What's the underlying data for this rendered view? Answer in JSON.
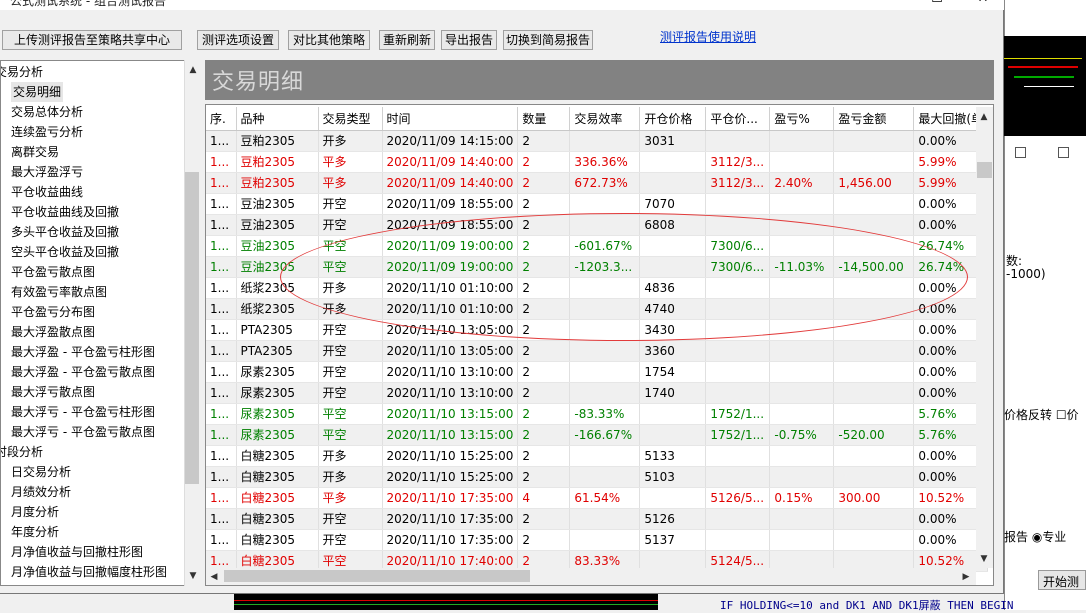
{
  "window": {
    "title": "公式测试系统 - 组合测试报告",
    "controls": {
      "minimize": "—",
      "maximize": "☐",
      "close": "✕"
    }
  },
  "toolbar": {
    "upload_label": "上传测评报告至策略共享中心",
    "options_label": "测评选项设置",
    "compare_label": "对比其他策略",
    "refresh_label": "重新刷新",
    "export_label": "导出报告",
    "switch_label": "切换到简易报告",
    "help_link": "测评报告使用说明"
  },
  "tree": {
    "items": [
      {
        "label": "交易分析",
        "level": 0
      },
      {
        "label": "交易明细",
        "level": 1,
        "selected": true
      },
      {
        "label": "交易总体分析",
        "level": 1
      },
      {
        "label": "连续盈亏分析",
        "level": 1
      },
      {
        "label": "离群交易",
        "level": 1
      },
      {
        "label": "最大浮盈浮亏",
        "level": 1
      },
      {
        "label": "平仓收益曲线",
        "level": 1
      },
      {
        "label": "平仓收益曲线及回撤",
        "level": 1
      },
      {
        "label": "多头平仓收益及回撤",
        "level": 1
      },
      {
        "label": "空头平仓收益及回撤",
        "level": 1
      },
      {
        "label": "平仓盈亏散点图",
        "level": 1
      },
      {
        "label": "有效盈亏率散点图",
        "level": 1
      },
      {
        "label": "平仓盈亏分布图",
        "level": 1
      },
      {
        "label": "最大浮盈散点图",
        "level": 1
      },
      {
        "label": "最大浮盈 - 平仓盈亏柱形图",
        "level": 1
      },
      {
        "label": "最大浮盈 - 平仓盈亏散点图",
        "level": 1
      },
      {
        "label": "最大浮亏散点图",
        "level": 1
      },
      {
        "label": "最大浮亏 - 平仓盈亏柱形图",
        "level": 1
      },
      {
        "label": "最大浮亏 - 平仓盈亏散点图",
        "level": 1
      },
      {
        "label": "时段分析",
        "level": 0
      },
      {
        "label": "日交易分析",
        "level": 1
      },
      {
        "label": "月绩效分析",
        "level": 1
      },
      {
        "label": "月度分析",
        "level": 1
      },
      {
        "label": "年度分析",
        "level": 1
      },
      {
        "label": "月净值收益与回撤柱形图",
        "level": 1
      },
      {
        "label": "月净值收益与回撤幅度柱形图",
        "level": 1
      }
    ]
  },
  "panel": {
    "header": "交易明细"
  },
  "table": {
    "columns": [
      "序.",
      "品种",
      "交易类型",
      "时间",
      "数量",
      "交易效率",
      "开仓价格",
      "平仓价...",
      "盈亏%",
      "盈亏金额",
      "最大回撤(单"
    ],
    "rows": [
      {
        "color": "blk",
        "cells": [
          "1...",
          "豆粕2305",
          "开多",
          "2020/11/09 14:15:00",
          "2",
          "",
          "3031",
          "",
          "",
          "",
          "0.00%"
        ]
      },
      {
        "color": "red",
        "cells": [
          "1...",
          "豆粕2305",
          "平多",
          "2020/11/09 14:40:00",
          "2",
          "336.36%",
          "",
          "3112/3...",
          "",
          "",
          "5.99%"
        ]
      },
      {
        "color": "red",
        "cells": [
          "1...",
          "豆粕2305",
          "平多",
          "2020/11/09 14:40:00",
          "2",
          "672.73%",
          "",
          "3112/3...",
          "2.40%",
          "1,456.00",
          "5.99%"
        ]
      },
      {
        "color": "blk",
        "cells": [
          "1...",
          "豆油2305",
          "开空",
          "2020/11/09 18:55:00",
          "2",
          "",
          "7070",
          "",
          "",
          "",
          "0.00%"
        ]
      },
      {
        "color": "blk",
        "cells": [
          "1...",
          "豆油2305",
          "开空",
          "2020/11/09 18:55:00",
          "2",
          "",
          "6808",
          "",
          "",
          "",
          "0.00%"
        ]
      },
      {
        "color": "grn",
        "cells": [
          "1...",
          "豆油2305",
          "平空",
          "2020/11/09 19:00:00",
          "2",
          "-601.67%",
          "",
          "7300/6...",
          "",
          "",
          "26.74%"
        ]
      },
      {
        "color": "grn",
        "cells": [
          "1...",
          "豆油2305",
          "平空",
          "2020/11/09 19:00:00",
          "2",
          "-1203.3...",
          "",
          "7300/6...",
          "-11.03%",
          "-14,500.00",
          "26.74%"
        ]
      },
      {
        "color": "blk",
        "cells": [
          "1...",
          "纸浆2305",
          "开多",
          "2020/11/10 01:10:00",
          "2",
          "",
          "4836",
          "",
          "",
          "",
          "0.00%"
        ]
      },
      {
        "color": "blk",
        "cells": [
          "1...",
          "纸浆2305",
          "开多",
          "2020/11/10 01:10:00",
          "2",
          "",
          "4740",
          "",
          "",
          "",
          "0.00%"
        ]
      },
      {
        "color": "blk",
        "cells": [
          "1...",
          "PTA2305",
          "开空",
          "2020/11/10 13:05:00",
          "2",
          "",
          "3430",
          "",
          "",
          "",
          "0.00%"
        ]
      },
      {
        "color": "blk",
        "cells": [
          "1...",
          "PTA2305",
          "开空",
          "2020/11/10 13:05:00",
          "2",
          "",
          "3360",
          "",
          "",
          "",
          "0.00%"
        ]
      },
      {
        "color": "blk",
        "cells": [
          "1...",
          "尿素2305",
          "开空",
          "2020/11/10 13:10:00",
          "2",
          "",
          "1754",
          "",
          "",
          "",
          "0.00%"
        ]
      },
      {
        "color": "blk",
        "cells": [
          "1...",
          "尿素2305",
          "开空",
          "2020/11/10 13:10:00",
          "2",
          "",
          "1740",
          "",
          "",
          "",
          "0.00%"
        ]
      },
      {
        "color": "grn",
        "cells": [
          "1...",
          "尿素2305",
          "平空",
          "2020/11/10 13:15:00",
          "2",
          "-83.33%",
          "",
          "1752/1...",
          "",
          "",
          "5.76%"
        ]
      },
      {
        "color": "grn",
        "cells": [
          "1...",
          "尿素2305",
          "平空",
          "2020/11/10 13:15:00",
          "2",
          "-166.67%",
          "",
          "1752/1...",
          "-0.75%",
          "-520.00",
          "5.76%"
        ]
      },
      {
        "color": "blk",
        "cells": [
          "1...",
          "白糖2305",
          "开多",
          "2020/11/10 15:25:00",
          "2",
          "",
          "5133",
          "",
          "",
          "",
          "0.00%"
        ]
      },
      {
        "color": "blk",
        "cells": [
          "1...",
          "白糖2305",
          "开多",
          "2020/11/10 15:25:00",
          "2",
          "",
          "5103",
          "",
          "",
          "",
          "0.00%"
        ]
      },
      {
        "color": "red",
        "cells": [
          "1...",
          "白糖2305",
          "平多",
          "2020/11/10 17:35:00",
          "4",
          "61.54%",
          "",
          "5126/5...",
          "0.15%",
          "300.00",
          "10.52%"
        ]
      },
      {
        "color": "blk",
        "cells": [
          "1...",
          "白糖2305",
          "开空",
          "2020/11/10 17:35:00",
          "2",
          "",
          "5126",
          "",
          "",
          "",
          "0.00%"
        ]
      },
      {
        "color": "blk",
        "cells": [
          "1...",
          "白糖2305",
          "开空",
          "2020/11/10 17:35:00",
          "2",
          "",
          "5137",
          "",
          "",
          "",
          "0.00%"
        ]
      },
      {
        "color": "red",
        "cells": [
          "1...",
          "白糖2305",
          "平空",
          "2020/11/10 17:40:00",
          "2",
          "83.33%",
          "",
          "5124/5...",
          "",
          "",
          "10.52%"
        ]
      }
    ]
  },
  "background_window": {
    "text1": "数:",
    "text2": "-1000)",
    "text3": "价格反转 ☐价",
    "text4": "报告 ◉专业",
    "start_button": "开始测",
    "code_line": "IF HOLDING<=10  and DK1  AND  DK1屏蔽    THEN BEGIN"
  },
  "colors": {
    "red": "#e00000",
    "green": "#008000",
    "header_gray": "#828282",
    "link": "#0033cc",
    "annotation": "#e23b3b"
  }
}
